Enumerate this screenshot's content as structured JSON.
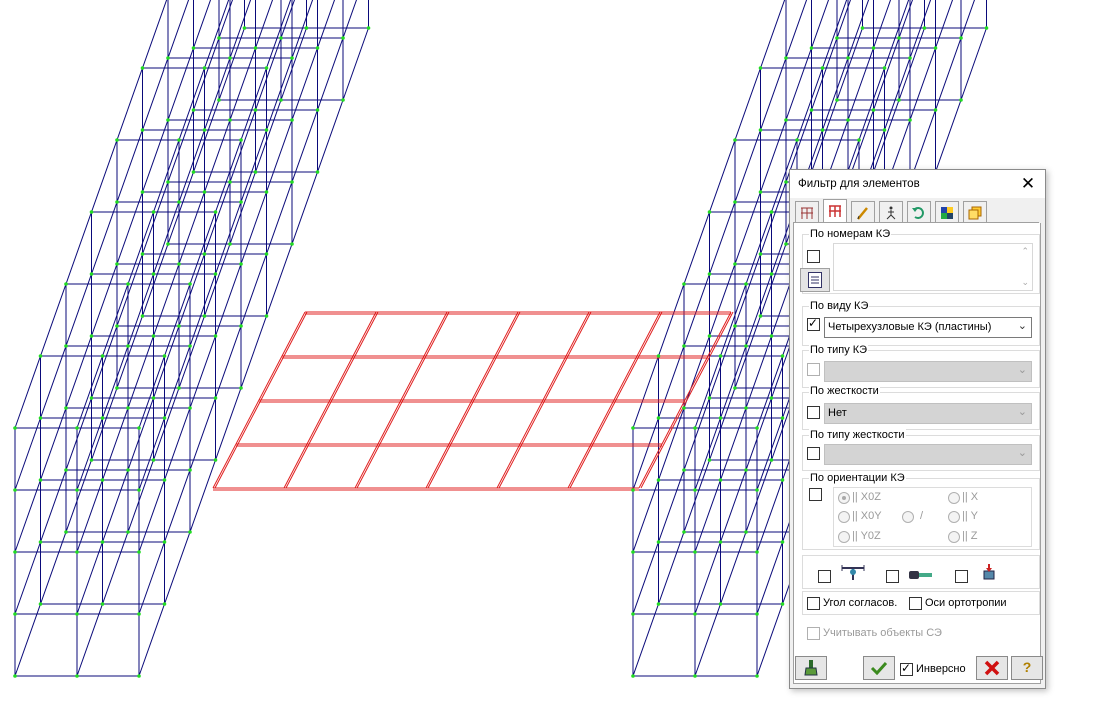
{
  "dialog": {
    "title": "Фильтр для элементов",
    "close_glyph": "✕",
    "tabs": [
      {
        "icon": "frame-nodes-icon"
      },
      {
        "icon": "frame-elements-icon",
        "active": true
      },
      {
        "icon": "pencil-icon"
      },
      {
        "icon": "figure-icon"
      },
      {
        "icon": "rotate-arrow-icon"
      },
      {
        "icon": "color-grid-icon"
      },
      {
        "icon": "copy-layers-icon"
      }
    ],
    "groups": {
      "by_numbers": {
        "label": "По номерам КЭ",
        "checked": false,
        "text": ""
      },
      "by_type_view": {
        "label": "По виду КЭ",
        "checked": true,
        "value": "Четырехузловые КЭ (пластины)",
        "arrow": "⌄"
      },
      "by_type": {
        "label": "По типу КЭ",
        "checked": false,
        "value": "",
        "arrow": "⌄"
      },
      "by_stiffness": {
        "label": "По жесткости",
        "checked": false,
        "value": "Нет",
        "arrow": "⌄"
      },
      "by_stiffness_type": {
        "label": "По типу жесткости",
        "checked": false,
        "value": "",
        "arrow": "⌄"
      },
      "by_orientation": {
        "label": "По ориентации КЭ",
        "checked": false,
        "options": {
          "xoz": "|| X0Z",
          "x": "|| X",
          "xoy": "|| X0Y",
          "slash": "/",
          "y": "|| Y",
          "yoz": "|| Y0Z",
          "z": "|| Z"
        },
        "selected": "xoz"
      }
    },
    "icon_row": [
      {
        "checked": false,
        "icon": "support-node-icon"
      },
      {
        "checked": false,
        "icon": "rigid-link-icon"
      },
      {
        "checked": false,
        "icon": "load-object-icon"
      }
    ],
    "angle_label": "Угол согласов.",
    "angle_checked": false,
    "ortho_label": "Оси ортотропии",
    "ortho_checked": false,
    "se_label": "Учитывать объекты СЭ",
    "se_checked": false,
    "inverse_label": "Инверсно",
    "inverse_checked": true,
    "buttons": {
      "brush": "brush-icon",
      "apply": "apply-check-icon",
      "cancel": "cancel-x-icon",
      "help": "?"
    }
  },
  "colors": {
    "frame": "#0a0a7a",
    "node": "#22dd22",
    "plate": "#e02020",
    "accent_cancel": "#d01010"
  }
}
